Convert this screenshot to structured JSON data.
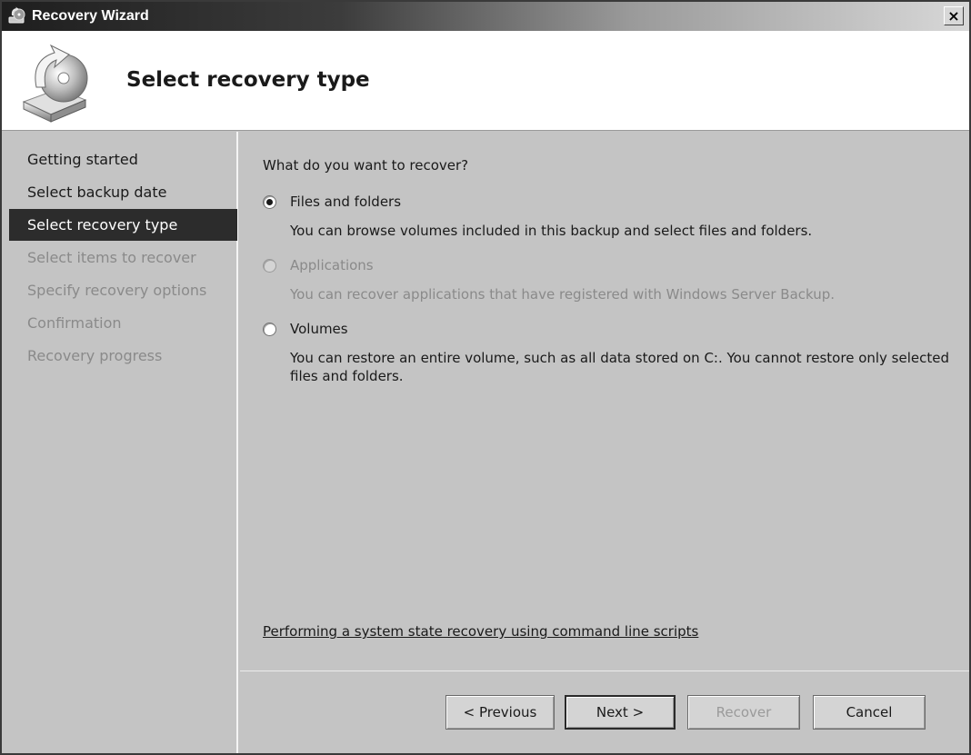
{
  "window": {
    "title": "Recovery Wizard",
    "close_label": "×"
  },
  "header": {
    "title": "Select recovery type"
  },
  "sidebar": {
    "items": [
      {
        "label": "Getting started",
        "state": "done"
      },
      {
        "label": "Select backup date",
        "state": "done"
      },
      {
        "label": "Select recovery type",
        "state": "active"
      },
      {
        "label": "Select items to recover",
        "state": "pending"
      },
      {
        "label": "Specify recovery options",
        "state": "pending"
      },
      {
        "label": "Confirmation",
        "state": "pending"
      },
      {
        "label": "Recovery progress",
        "state": "pending"
      }
    ]
  },
  "main": {
    "question": "What do you want to recover?",
    "options": [
      {
        "label": "Files and folders",
        "description": "You can browse volumes included in this backup and select files and folders.",
        "checked": true,
        "disabled": false
      },
      {
        "label": "Applications",
        "description": "You can recover applications that have registered with Windows Server Backup.",
        "checked": false,
        "disabled": true
      },
      {
        "label": "Volumes",
        "description": "You can restore an entire volume, such as all data stored on C:. You cannot restore only selected files and folders.",
        "checked": false,
        "disabled": false
      }
    ],
    "link": "Performing a system state recovery using command line scripts"
  },
  "footer": {
    "previous": "< Previous",
    "next": "Next >",
    "recover": "Recover",
    "cancel": "Cancel"
  }
}
